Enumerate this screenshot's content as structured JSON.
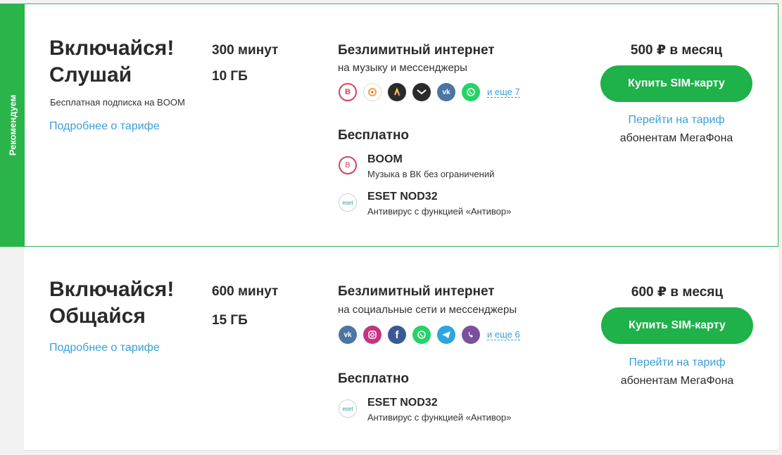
{
  "ribbon_label": "Рекомендуем",
  "buy_label": "Купить SIM-карту",
  "goto_label": "Перейти на тариф",
  "abon_label": "абонентам МегаФона",
  "more_link": "Подробнее о тарифе",
  "free_heading": "Бесплатно",
  "unlim_heading": "Безлимитный интернет",
  "card1": {
    "title_line1": "Включайся!",
    "title_line2": "Слушай",
    "subtitle": "Бесплатная подписка на BOOM",
    "minutes": "300 минут",
    "gb": "10 ГБ",
    "unlim_desc": "на музыку и мессенджеры",
    "icons": [
      "boom-icon",
      "ok-music-icon",
      "yandex-music-icon",
      "zvooq-icon",
      "vk-icon",
      "whatsapp-icon"
    ],
    "more_icons": "и еще 7",
    "services": [
      {
        "name": "BOOM",
        "desc": "Музыка в ВК без ограничений"
      },
      {
        "name": "ESET NOD32",
        "desc": "Антивирус с функцией «Антивор»"
      }
    ],
    "price": "500 ₽ в месяц"
  },
  "card2": {
    "title_line1": "Включайся!",
    "title_line2": "Общайся",
    "minutes": "600 минут",
    "gb": "15 ГБ",
    "unlim_desc": "на социальные сети и мессенджеры",
    "icons": [
      "vk-icon",
      "instagram-icon",
      "facebook-icon",
      "whatsapp-icon",
      "telegram-icon",
      "viber-icon"
    ],
    "more_icons": "и еще 6",
    "services": [
      {
        "name": "ESET NOD32",
        "desc": "Антивирус с функцией «Антивор»"
      }
    ],
    "price": "600 ₽ в месяц"
  },
  "colors": {
    "brand_green": "#1fb14a",
    "link_blue": "#3a9fd8",
    "text": "#2a2a2a"
  }
}
